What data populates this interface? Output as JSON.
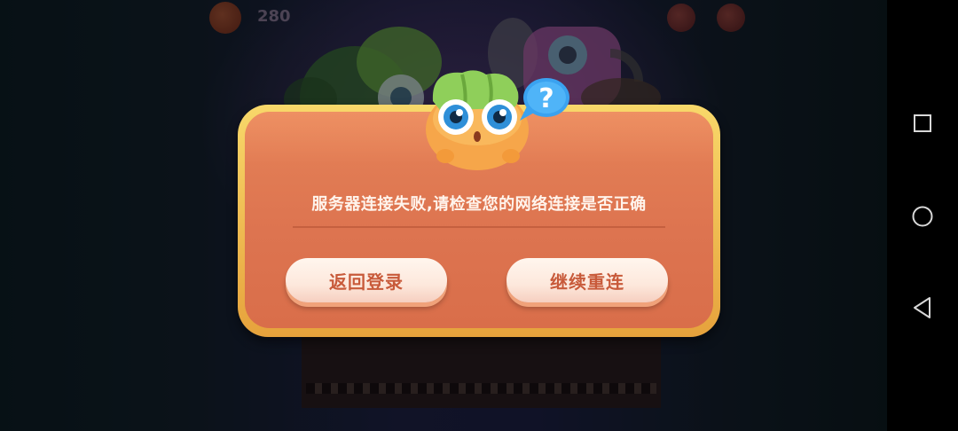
{
  "hud": {
    "coin_count": "280"
  },
  "dialog": {
    "message": "服务器连接失败,请检查您的网络连接是否正确",
    "back_button_label": "返回登录",
    "retry_button_label": "继续重连"
  },
  "mascot": {
    "badge_symbol": "?"
  },
  "icons": {
    "coin": "coin-icon",
    "mascot": "carrot-mascot-icon",
    "question_badge": "question-bubble-icon",
    "recent_apps": "square-icon",
    "home": "circle-icon",
    "back": "triangle-back-icon"
  },
  "colors": {
    "dialog_frame": "#f3c55a",
    "dialog_body": "#e07a52",
    "button_text": "#c85a3a",
    "button_fill": "#fdeadf"
  }
}
